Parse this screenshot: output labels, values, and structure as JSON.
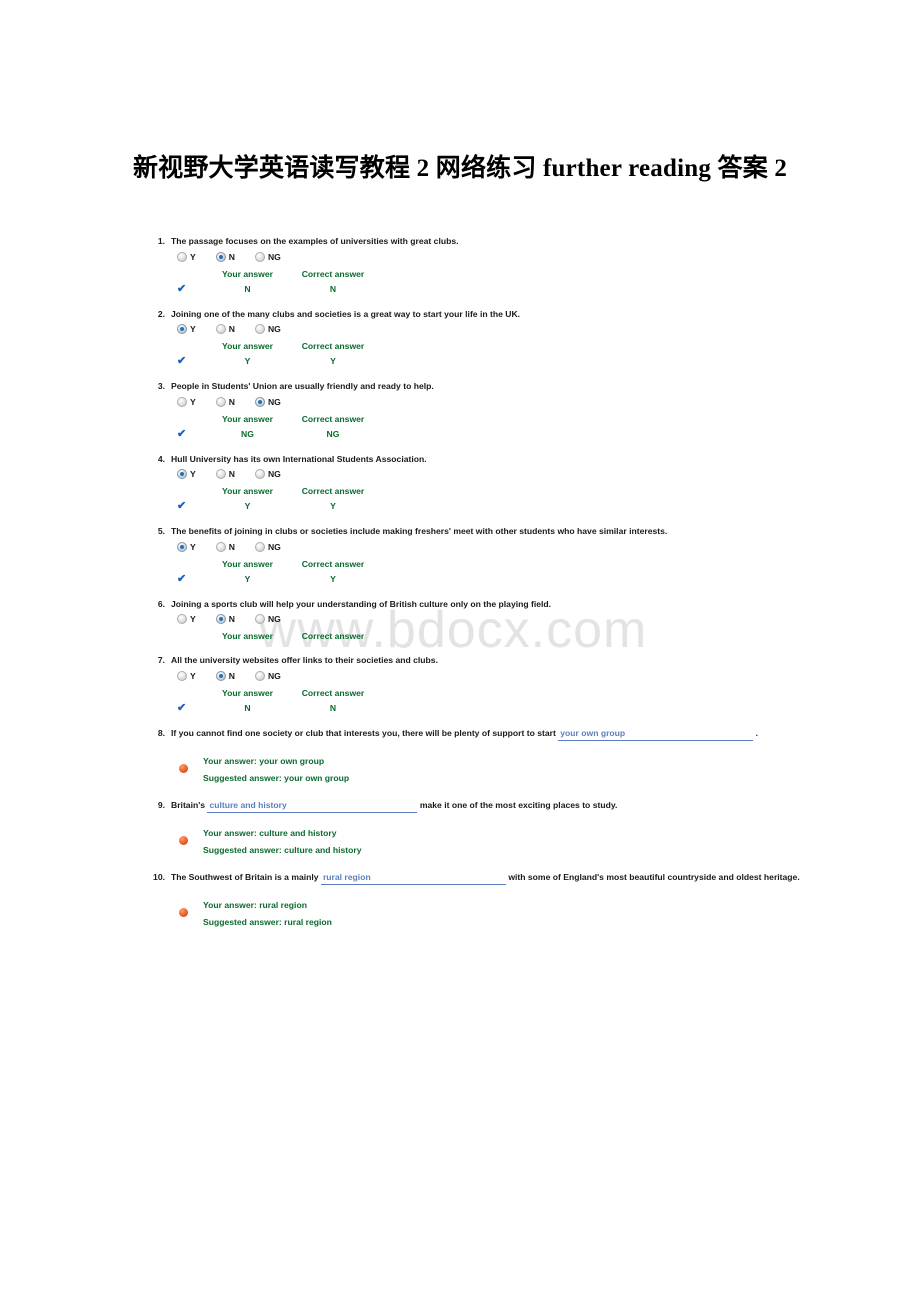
{
  "document": {
    "title": "新视野大学英语读写教程 2 网络练习 further reading 答案 2"
  },
  "watermark": {
    "text": "www.bdocx.com"
  },
  "labels": {
    "your_answer": "Your answer",
    "correct_answer": "Correct answer",
    "your_answer_prefix": "Your answer:",
    "suggested_answer_prefix": "Suggested answer:",
    "check_mark": "✔",
    "option_y": "Y",
    "option_n": "N",
    "option_ng": "NG",
    "period": "."
  },
  "colors": {
    "answer_green": "#0b6b2e",
    "check_blue": "#1f5fbf",
    "blank_blue": "#5b7fbe",
    "bullet_orange": "#ef6a2c",
    "watermark_gray": "#e3e3e3"
  },
  "questions": [
    {
      "number": "1.",
      "text": "The passage focuses on the examples of universities with great clubs.",
      "selected": "N",
      "your_answer": "N",
      "correct_answer": "N",
      "show_answers": true
    },
    {
      "number": "2.",
      "text": "Joining one of the many clubs and societies is a great way to start your life in the UK.",
      "selected": "Y",
      "your_answer": "Y",
      "correct_answer": "Y",
      "show_answers": true
    },
    {
      "number": "3.",
      "text": "People in Students' Union are usually friendly and ready to help.",
      "selected": "NG",
      "your_answer": "NG",
      "correct_answer": "NG",
      "show_answers": true
    },
    {
      "number": "4.",
      "text": "Hull University has its own International Students Association.",
      "selected": "Y",
      "your_answer": "Y",
      "correct_answer": "Y",
      "show_answers": true
    },
    {
      "number": "5.",
      "text": "The benefits of joining in clubs or societies include making freshers' meet with other students who have similar interests.",
      "selected": "Y",
      "your_answer": "Y",
      "correct_answer": "Y",
      "show_answers": true
    },
    {
      "number": "6.",
      "text": "Joining a sports club will help your understanding of British culture only on the playing field.",
      "selected": "N",
      "your_answer": "",
      "correct_answer": "",
      "show_answers": false
    },
    {
      "number": "7.",
      "text": "All the university websites offer links to their societies and clubs.",
      "selected": "N",
      "your_answer": "N",
      "correct_answer": "N",
      "show_answers": true
    }
  ],
  "fill_in_questions": [
    {
      "number": "8.",
      "text_before": "If you cannot find one society or club that interests you, there will be plenty of support to start",
      "blank_value": "your own group",
      "text_after": ".",
      "your_answer": "Your answer: your own group",
      "suggested_answer": "Suggested answer: your own group"
    },
    {
      "number": "9.",
      "text_before": "Britain's",
      "blank_value": "culture and history",
      "text_after": "make it one of the most exciting places to study.",
      "your_answer": "Your answer: culture and history",
      "suggested_answer": "Suggested answer: culture and history"
    },
    {
      "number": "10.",
      "text_before": "The Southwest of Britain is a mainly",
      "blank_value": "rural region",
      "text_after": "with some of England's most beautiful countryside and oldest heritage.",
      "your_answer": "Your answer: rural region",
      "suggested_answer": "Suggested answer: rural region"
    }
  ]
}
